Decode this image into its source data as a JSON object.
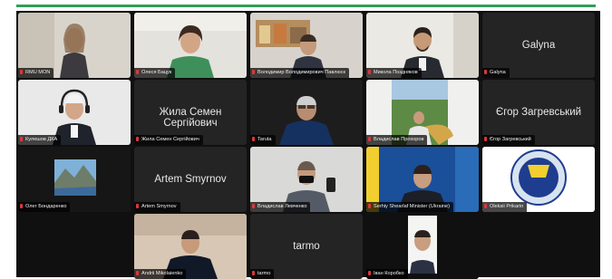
{
  "participants": [
    {
      "name": "RMU MON",
      "type": "video"
    },
    {
      "name": "Олеся Бацук",
      "type": "video"
    },
    {
      "name": "Володимир Володимирович Павлюск",
      "type": "video"
    },
    {
      "name": "Микола Поздняков",
      "type": "video"
    },
    {
      "name": "Galyna",
      "type": "name"
    },
    {
      "name": "Кулешов ДКА",
      "type": "video"
    },
    {
      "name": "Жила Семен Сергійович",
      "type": "name"
    },
    {
      "name": "Taruta",
      "type": "video"
    },
    {
      "name": "Владислав Прохоров",
      "type": "video"
    },
    {
      "name": "Єгор Загревський",
      "type": "name"
    },
    {
      "name": "Олег Бондаренко",
      "type": "video"
    },
    {
      "name": "Artem Smyrnov",
      "type": "name"
    },
    {
      "name": "Владислав Левченко",
      "type": "video"
    },
    {
      "name": "Serhiy Shearlaf Minister (Ukraine)",
      "type": "video",
      "active_speaker": true
    },
    {
      "name": "Oleksii Prikarin",
      "type": "video"
    },
    {
      "name": "Andrii Mikolaienko",
      "type": "video"
    },
    {
      "name": "tarmo",
      "type": "name"
    },
    {
      "name": "Іван Коробко",
      "type": "video"
    }
  ],
  "colors": {
    "gallery_bg": "#101010",
    "tile_bg": "#242424",
    "active_border": "#2fbf4e",
    "muted_mic": "#e0353a",
    "top_rule": "#2f9e58"
  }
}
